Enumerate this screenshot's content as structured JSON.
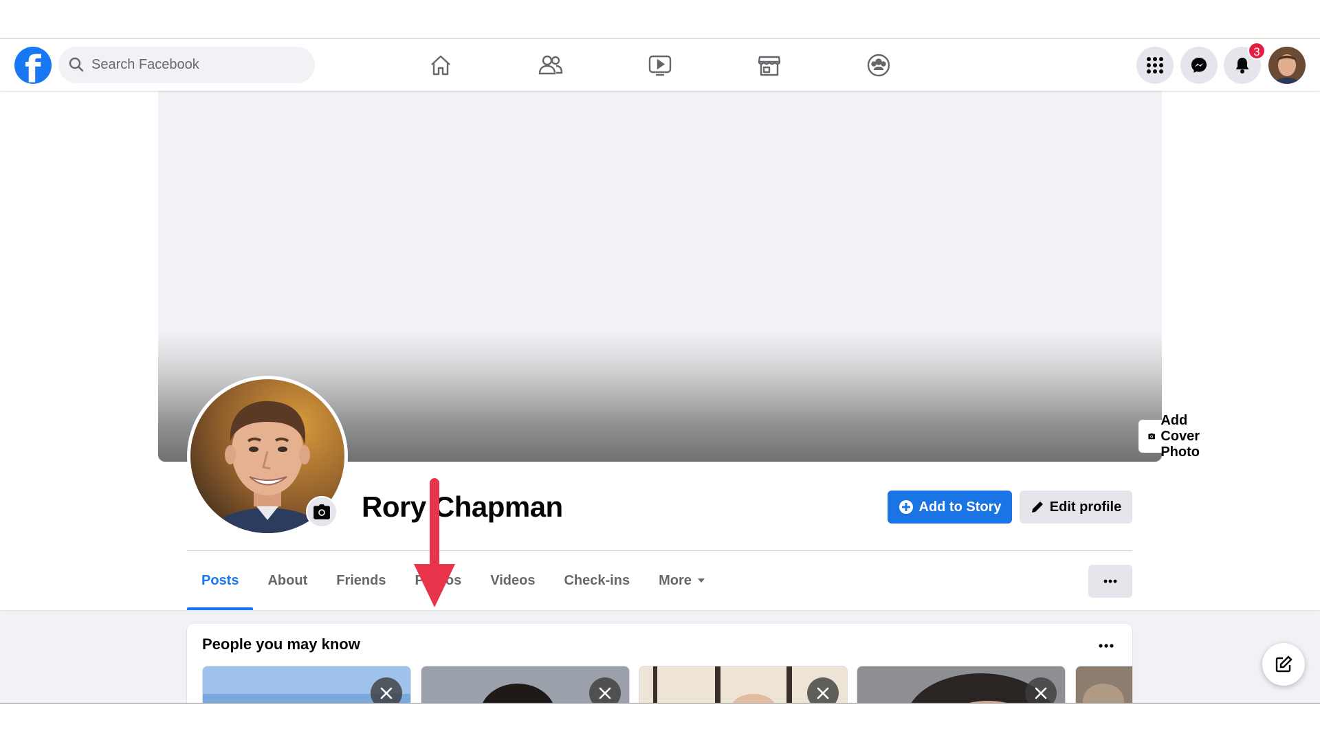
{
  "topbar": {
    "logo_icon": "facebook-logo-icon",
    "search_placeholder": "Search Facebook",
    "nav_icons": [
      "home-icon",
      "friends-icon",
      "watch-icon",
      "marketplace-icon",
      "groups-icon"
    ],
    "right_icons": [
      "menu-grid-icon",
      "messenger-icon",
      "notifications-bell-icon"
    ],
    "notification_count": "3"
  },
  "profile": {
    "name": "Rory Chapman",
    "add_cover_label": "Add Cover Photo",
    "add_story_label": "Add to Story",
    "edit_profile_label": "Edit profile"
  },
  "tabs": [
    {
      "label": "Posts",
      "active": true
    },
    {
      "label": "About",
      "active": false
    },
    {
      "label": "Friends",
      "active": false
    },
    {
      "label": "Photos",
      "active": false
    },
    {
      "label": "Videos",
      "active": false
    },
    {
      "label": "Check-ins",
      "active": false
    },
    {
      "label": "More",
      "active": false
    }
  ],
  "pymk": {
    "title": "People you may know"
  },
  "annotation": {
    "arrow_color": "#e8344a",
    "arrow_target": "Photos"
  },
  "colors": {
    "accent": "#1877f2",
    "badge": "#e41e3f"
  }
}
